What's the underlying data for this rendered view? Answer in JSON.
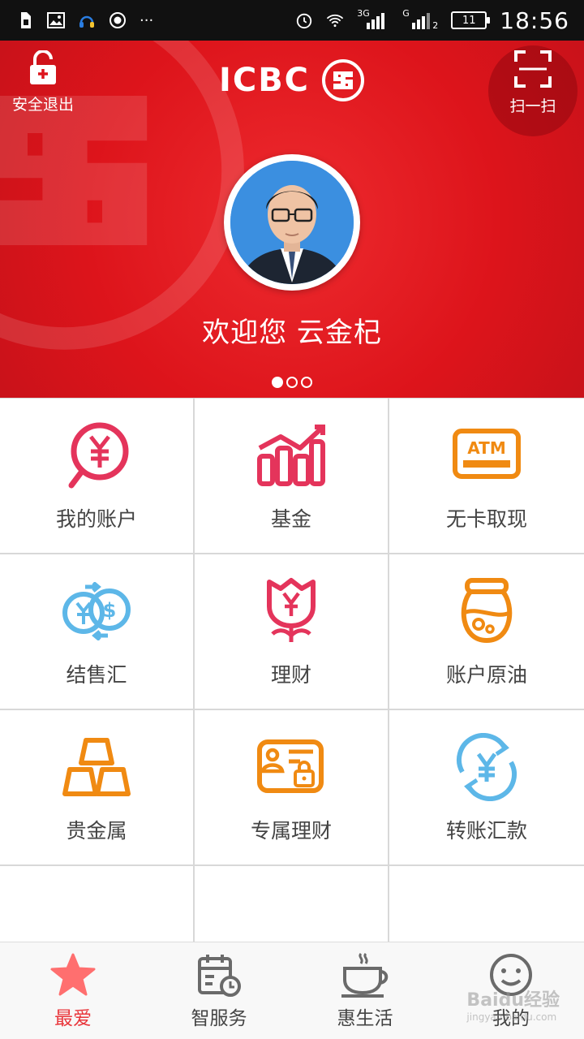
{
  "status_bar": {
    "time": "18:56",
    "battery": "11",
    "net_3g": "3G",
    "net_g": "G",
    "sim2": "2",
    "more": "···"
  },
  "hero": {
    "brand": "ICBC",
    "logout_label": "安全退出",
    "scan_label": "扫一扫",
    "welcome": "欢迎您 云金杞",
    "page_dots": 3,
    "active_dot": 1
  },
  "grid": {
    "items": [
      {
        "label": "我的账户",
        "icon": "account-yuan-icon"
      },
      {
        "label": "基金",
        "icon": "fund-chart-icon"
      },
      {
        "label": "无卡取现",
        "icon": "atm-icon"
      },
      {
        "label": "结售汇",
        "icon": "exchange-icon"
      },
      {
        "label": "理财",
        "icon": "flower-yuan-icon"
      },
      {
        "label": "账户原油",
        "icon": "oil-jar-icon"
      },
      {
        "label": "贵金属",
        "icon": "gold-bars-icon"
      },
      {
        "label": "专属理财",
        "icon": "exclusive-card-icon"
      },
      {
        "label": "转账汇款",
        "icon": "transfer-icon"
      }
    ]
  },
  "nav": {
    "items": [
      {
        "label": "最爱",
        "icon": "star-icon",
        "active": true
      },
      {
        "label": "智服务",
        "icon": "calendar-clock-icon",
        "active": false
      },
      {
        "label": "惠生活",
        "icon": "coffee-cup-icon",
        "active": false
      },
      {
        "label": "我的",
        "icon": "smiley-icon",
        "active": false
      }
    ]
  },
  "watermark": {
    "brand": "Baidu经验",
    "url": "jingyan.baidu.com"
  },
  "colors": {
    "hero_red": "#dd141b",
    "pink": "#e4345b",
    "orange": "#f08a12",
    "blue": "#5db7e8",
    "active_nav": "#ff6f6f"
  }
}
